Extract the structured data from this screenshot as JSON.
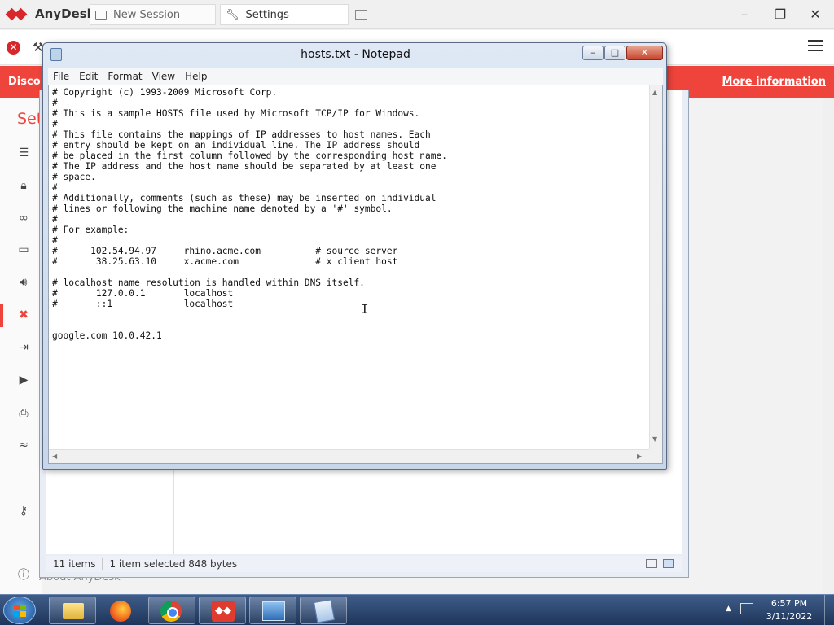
{
  "anydesk": {
    "app_name": "AnyDesk",
    "tabs": [
      {
        "label": "New Session"
      },
      {
        "label": "Settings"
      }
    ],
    "banner_left": "Disco",
    "banner_right": "More information",
    "settings_title": "Set",
    "about_label": "About AnyDesk",
    "sidebar_icons": [
      "list-icon",
      "lock-icon",
      "glasses-icon",
      "monitor-icon",
      "speaker-icon",
      "connection-icon",
      "file-transfer-icon",
      "recording-icon",
      "printer-icon",
      "wifi-icon",
      "key-icon"
    ],
    "accent_color": "#ef443b"
  },
  "explorer": {
    "status_items": "11 items",
    "status_selected": "1 item selected  848 bytes"
  },
  "notepad": {
    "title": "hosts.txt - Notepad",
    "menu": [
      "File",
      "Edit",
      "Format",
      "View",
      "Help"
    ],
    "content": "# Copyright (c) 1993-2009 Microsoft Corp.\n#\n# This is a sample HOSTS file used by Microsoft TCP/IP for Windows.\n#\n# This file contains the mappings of IP addresses to host names. Each\n# entry should be kept on an individual line. The IP address should\n# be placed in the first column followed by the corresponding host name.\n# The IP address and the host name should be separated by at least one\n# space.\n#\n# Additionally, comments (such as these) may be inserted on individual\n# lines or following the machine name denoted by a '#' symbol.\n#\n# For example:\n#\n#      102.54.94.97     rhino.acme.com          # source server\n#       38.25.63.10     x.acme.com              # x client host\n\n# localhost name resolution is handled within DNS itself.\n#\t127.0.0.1       localhost\n#\t::1             localhost\n\n\ngoogle.com 10.0.42.1"
  },
  "taskbar": {
    "apps": [
      "windows-explorer",
      "firefox",
      "chrome",
      "anydesk",
      "control-panel",
      "notepad"
    ],
    "time": "6:57 PM",
    "date": "3/11/2022"
  }
}
